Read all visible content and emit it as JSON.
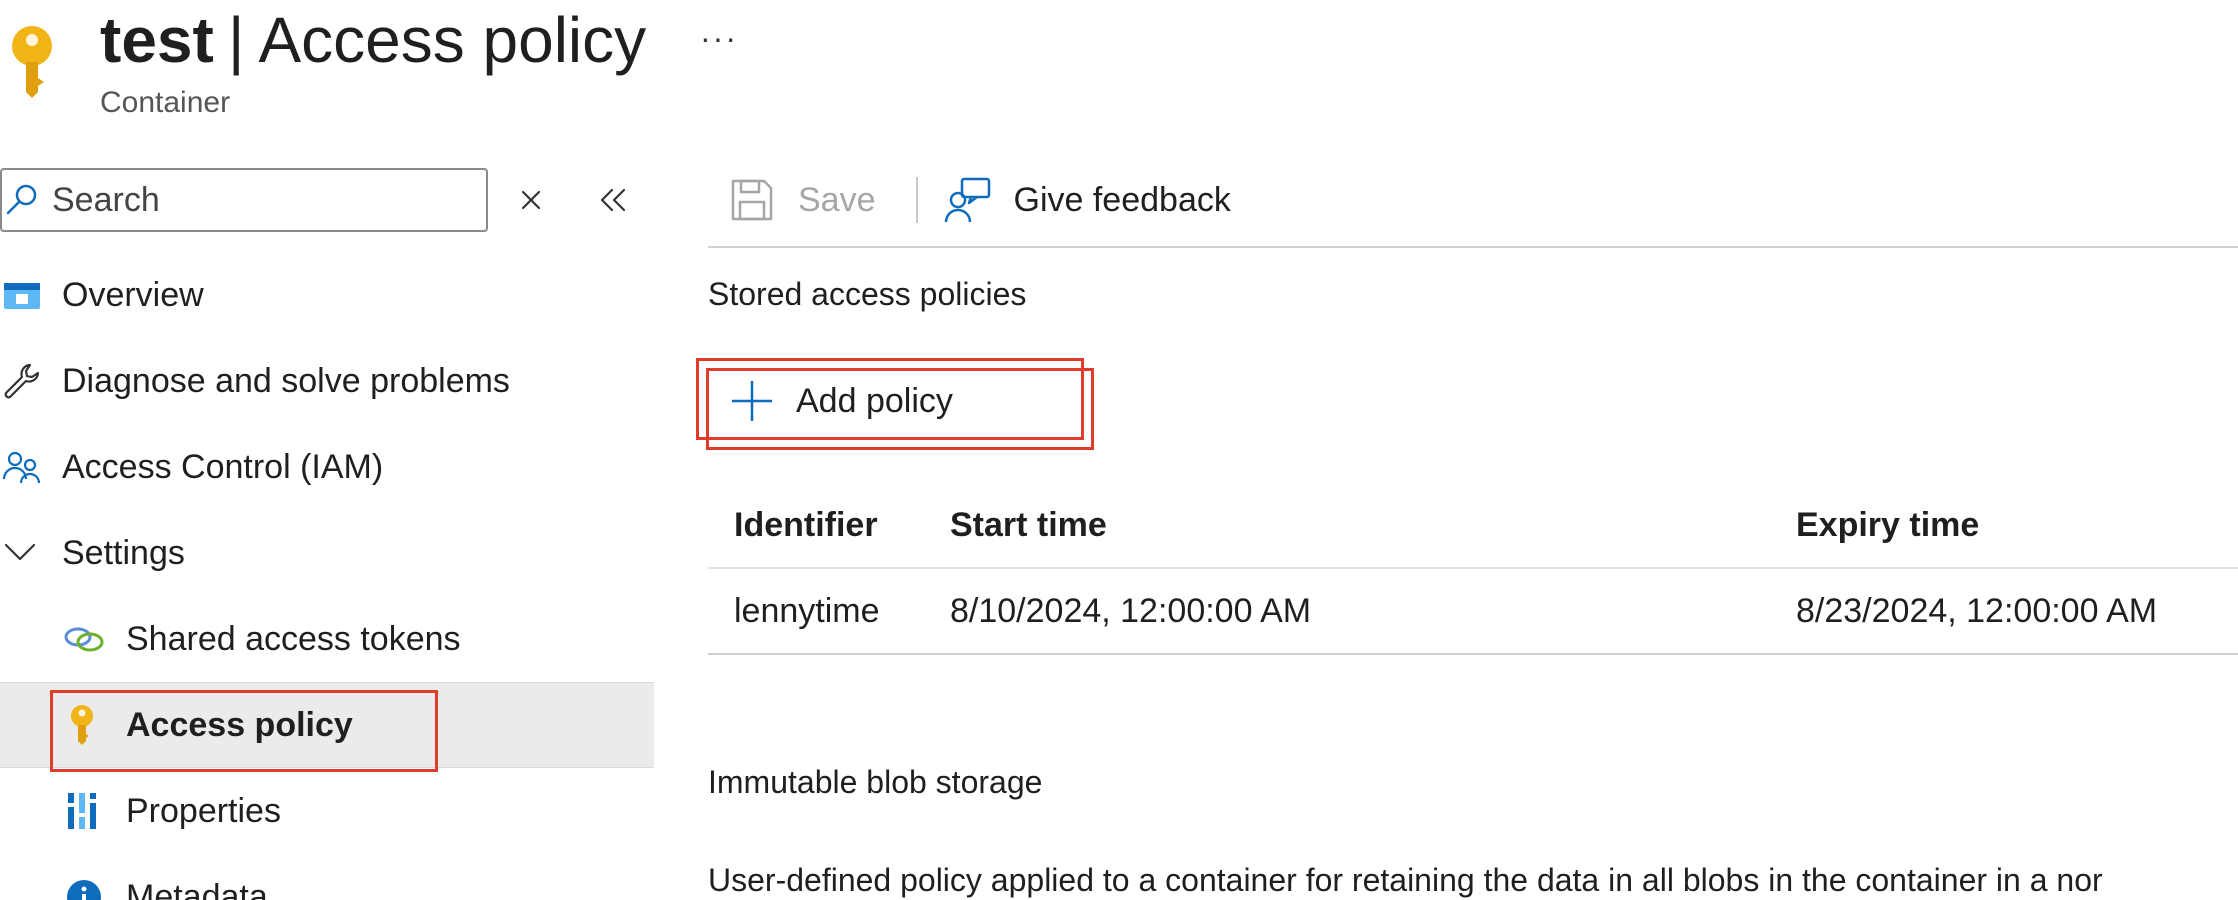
{
  "header": {
    "resource_name": "test",
    "separator": "|",
    "page_name": "Access policy",
    "resource_type": "Container",
    "more_label": "···"
  },
  "sidebar": {
    "search_placeholder": "Search",
    "items": [
      {
        "label": "Overview",
        "icon": "overview-icon"
      },
      {
        "label": "Diagnose and solve problems",
        "icon": "wrench-icon"
      },
      {
        "label": "Access Control (IAM)",
        "icon": "people-icon"
      },
      {
        "label": "Settings",
        "icon": "chevron-down-icon"
      },
      {
        "label": "Shared access tokens",
        "icon": "link-icon"
      },
      {
        "label": "Access policy",
        "icon": "key-icon",
        "selected": true
      },
      {
        "label": "Properties",
        "icon": "properties-icon"
      },
      {
        "label": "Metadata",
        "icon": "info-icon"
      }
    ]
  },
  "toolbar": {
    "save_label": "Save",
    "feedback_label": "Give feedback"
  },
  "main": {
    "stored_policies_title": "Stored access policies",
    "add_policy_label": "Add policy",
    "table": {
      "headers": [
        "Identifier",
        "Start time",
        "Expiry time"
      ],
      "rows": [
        [
          "lennytime",
          "8/10/2024, 12:00:00 AM",
          "8/23/2024, 12:00:00 AM"
        ]
      ]
    },
    "immutable_title": "Immutable blob storage",
    "immutable_description": "User-defined policy applied to a container for retaining the data in all blobs in the container in a nor"
  },
  "colors": {
    "accent_blue": "#0f6cbd",
    "key_yellow": "#f2b517",
    "highlight_red": "#e03c2a",
    "selected_bg": "#ebebeb"
  }
}
